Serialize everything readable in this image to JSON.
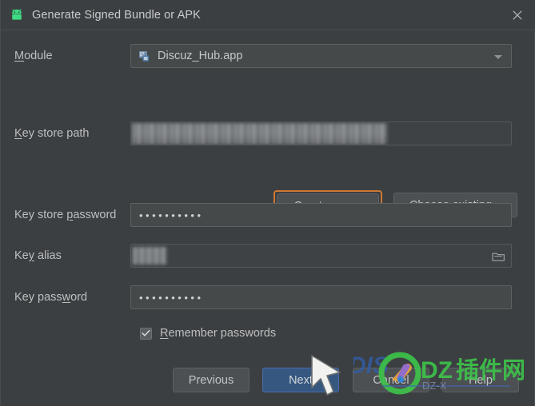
{
  "window": {
    "title": "Generate Signed Bundle or APK",
    "app_icon": "android-robot-icon",
    "close_icon": "close-icon"
  },
  "form": {
    "module": {
      "label": "Module",
      "mnemonic": "M",
      "value": "Discuz_Hub.app",
      "icon": "android-module-icon",
      "dropdown_icon": "chevron-down-icon"
    },
    "key_store_path": {
      "label": "Key store path",
      "mnemonic": "K",
      "value": "",
      "redacted": true
    },
    "create_new": {
      "label": "Create new...",
      "mnemonic": "C",
      "focused": true,
      "focus_color": "#cc7832"
    },
    "choose_existing": {
      "label": "Choose existing...",
      "mnemonic": "h"
    },
    "key_store_password": {
      "label": "Key store password",
      "mnemonic": "p",
      "value": "••••••••••",
      "masked": true
    },
    "key_alias": {
      "label": "Key alias",
      "mnemonic": "y",
      "value": "",
      "redacted": true,
      "browse_icon": "folder-icon"
    },
    "key_password": {
      "label": "Key password",
      "mnemonic": "w",
      "value": "••••••••••",
      "masked": true
    },
    "remember_passwords": {
      "label": "Remember passwords",
      "mnemonic": "R",
      "checked": true,
      "check_icon": "checkmark-icon"
    }
  },
  "buttons": {
    "previous": {
      "label": "Previous",
      "mnemonic": "P"
    },
    "next": {
      "label": "Next",
      "mnemonic": "N",
      "default": true,
      "color": "#365880"
    },
    "cancel": {
      "label": "Cancel",
      "mnemonic": "C"
    },
    "help": {
      "label": "Help",
      "mnemonic": "H"
    }
  },
  "overlay": {
    "watermark_text": "DZ插件网",
    "watermark_secondary": "DIS",
    "watermark_tertiary": "DZ-X",
    "watermark_color": "#3dc24a",
    "cursor_icon": "mouse-pointer-icon"
  },
  "theme": {
    "background": "#3c3f41",
    "field_background": "#45494a",
    "text": "#bdbfc1",
    "accent": "#cc7832",
    "default_button": "#365880"
  }
}
